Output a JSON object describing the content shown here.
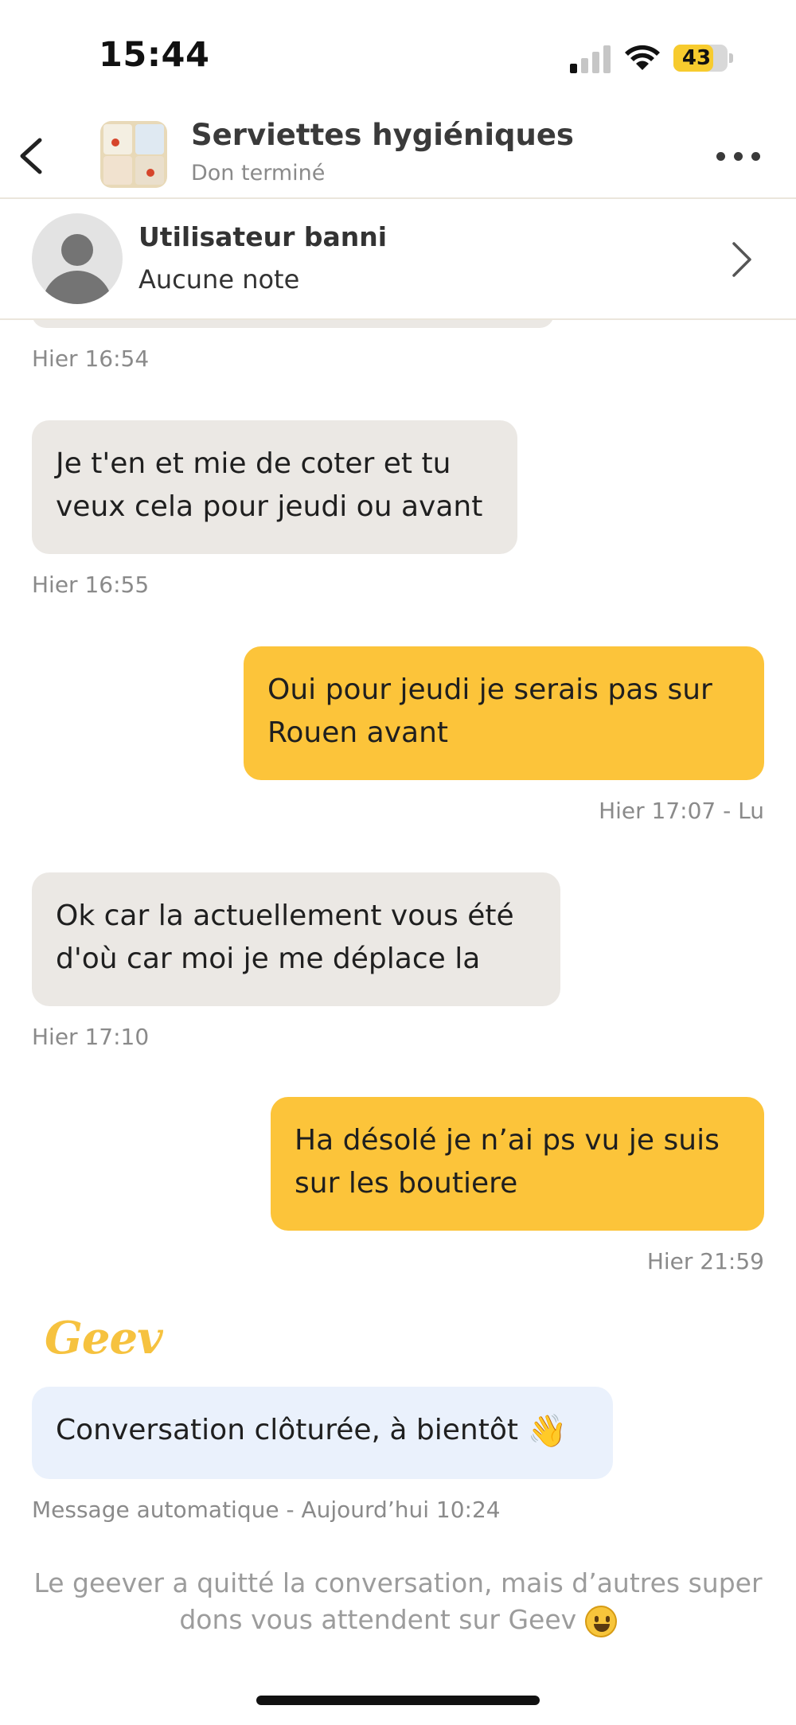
{
  "status_bar": {
    "time": "15:44",
    "battery": "43"
  },
  "header": {
    "title": "Serviettes hygiéniques",
    "subtitle": "Don terminé"
  },
  "user": {
    "name": "Utilisateur banni",
    "rating": "Aucune note"
  },
  "messages": [
    {
      "direction": "in",
      "lines": [],
      "meta": "Hier 16:54"
    },
    {
      "direction": "in",
      "lines": [
        "Je t'en et mie de coter et tu",
        "veux cela pour jeudi ou avant"
      ],
      "meta": "Hier 16:55"
    },
    {
      "direction": "out",
      "lines": [
        "Oui pour jeudi je serais pas sur",
        "Rouen avant"
      ],
      "meta": "Hier 17:07 - Lu"
    },
    {
      "direction": "in",
      "lines": [
        "Ok car la actuellement vous été",
        "d'où car moi je me déplace la"
      ],
      "meta": "Hier 17:10"
    },
    {
      "direction": "out",
      "lines": [
        "Ha désolé je n’ai ps vu je suis",
        "sur les boutiere"
      ],
      "meta": "Hier 21:59"
    }
  ],
  "auto_message": {
    "brand": "Geev",
    "text": "Conversation clôturée, à bientôt",
    "emoji": "👋",
    "meta": "Message automatique - Aujourd’hui 10:24"
  },
  "footer_notice": {
    "line1": "Le geever a quitté la conversation, mais d’autres super",
    "line2": "dons vous attendent sur Geev"
  },
  "colors": {
    "outgoing_bubble": "#fcc43a",
    "incoming_bubble": "#ebe8e4",
    "auto_bubble": "#eaf1fc",
    "brand": "#f6c23f"
  },
  "icons": {
    "back": "chevron-left-icon",
    "more": "more-dots-icon",
    "profile": "chevron-right-icon",
    "avatar": "person-placeholder-icon"
  }
}
